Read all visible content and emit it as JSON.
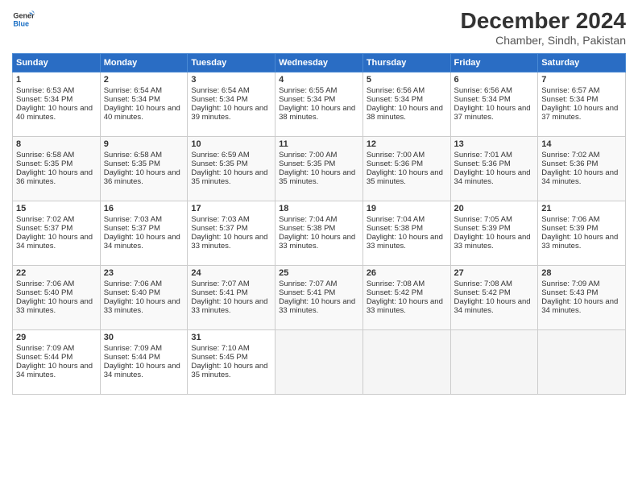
{
  "header": {
    "logo_line1": "General",
    "logo_line2": "Blue",
    "month": "December 2024",
    "location": "Chamber, Sindh, Pakistan"
  },
  "days_of_week": [
    "Sunday",
    "Monday",
    "Tuesday",
    "Wednesday",
    "Thursday",
    "Friday",
    "Saturday"
  ],
  "weeks": [
    [
      {
        "day": "1",
        "sunrise": "6:53 AM",
        "sunset": "5:34 PM",
        "daylight": "10 hours and 40 minutes."
      },
      {
        "day": "2",
        "sunrise": "6:54 AM",
        "sunset": "5:34 PM",
        "daylight": "10 hours and 40 minutes."
      },
      {
        "day": "3",
        "sunrise": "6:54 AM",
        "sunset": "5:34 PM",
        "daylight": "10 hours and 39 minutes."
      },
      {
        "day": "4",
        "sunrise": "6:55 AM",
        "sunset": "5:34 PM",
        "daylight": "10 hours and 38 minutes."
      },
      {
        "day": "5",
        "sunrise": "6:56 AM",
        "sunset": "5:34 PM",
        "daylight": "10 hours and 38 minutes."
      },
      {
        "day": "6",
        "sunrise": "6:56 AM",
        "sunset": "5:34 PM",
        "daylight": "10 hours and 37 minutes."
      },
      {
        "day": "7",
        "sunrise": "6:57 AM",
        "sunset": "5:34 PM",
        "daylight": "10 hours and 37 minutes."
      }
    ],
    [
      {
        "day": "8",
        "sunrise": "6:58 AM",
        "sunset": "5:35 PM",
        "daylight": "10 hours and 36 minutes."
      },
      {
        "day": "9",
        "sunrise": "6:58 AM",
        "sunset": "5:35 PM",
        "daylight": "10 hours and 36 minutes."
      },
      {
        "day": "10",
        "sunrise": "6:59 AM",
        "sunset": "5:35 PM",
        "daylight": "10 hours and 35 minutes."
      },
      {
        "day": "11",
        "sunrise": "7:00 AM",
        "sunset": "5:35 PM",
        "daylight": "10 hours and 35 minutes."
      },
      {
        "day": "12",
        "sunrise": "7:00 AM",
        "sunset": "5:36 PM",
        "daylight": "10 hours and 35 minutes."
      },
      {
        "day": "13",
        "sunrise": "7:01 AM",
        "sunset": "5:36 PM",
        "daylight": "10 hours and 34 minutes."
      },
      {
        "day": "14",
        "sunrise": "7:02 AM",
        "sunset": "5:36 PM",
        "daylight": "10 hours and 34 minutes."
      }
    ],
    [
      {
        "day": "15",
        "sunrise": "7:02 AM",
        "sunset": "5:37 PM",
        "daylight": "10 hours and 34 minutes."
      },
      {
        "day": "16",
        "sunrise": "7:03 AM",
        "sunset": "5:37 PM",
        "daylight": "10 hours and 34 minutes."
      },
      {
        "day": "17",
        "sunrise": "7:03 AM",
        "sunset": "5:37 PM",
        "daylight": "10 hours and 33 minutes."
      },
      {
        "day": "18",
        "sunrise": "7:04 AM",
        "sunset": "5:38 PM",
        "daylight": "10 hours and 33 minutes."
      },
      {
        "day": "19",
        "sunrise": "7:04 AM",
        "sunset": "5:38 PM",
        "daylight": "10 hours and 33 minutes."
      },
      {
        "day": "20",
        "sunrise": "7:05 AM",
        "sunset": "5:39 PM",
        "daylight": "10 hours and 33 minutes."
      },
      {
        "day": "21",
        "sunrise": "7:06 AM",
        "sunset": "5:39 PM",
        "daylight": "10 hours and 33 minutes."
      }
    ],
    [
      {
        "day": "22",
        "sunrise": "7:06 AM",
        "sunset": "5:40 PM",
        "daylight": "10 hours and 33 minutes."
      },
      {
        "day": "23",
        "sunrise": "7:06 AM",
        "sunset": "5:40 PM",
        "daylight": "10 hours and 33 minutes."
      },
      {
        "day": "24",
        "sunrise": "7:07 AM",
        "sunset": "5:41 PM",
        "daylight": "10 hours and 33 minutes."
      },
      {
        "day": "25",
        "sunrise": "7:07 AM",
        "sunset": "5:41 PM",
        "daylight": "10 hours and 33 minutes."
      },
      {
        "day": "26",
        "sunrise": "7:08 AM",
        "sunset": "5:42 PM",
        "daylight": "10 hours and 33 minutes."
      },
      {
        "day": "27",
        "sunrise": "7:08 AM",
        "sunset": "5:42 PM",
        "daylight": "10 hours and 34 minutes."
      },
      {
        "day": "28",
        "sunrise": "7:09 AM",
        "sunset": "5:43 PM",
        "daylight": "10 hours and 34 minutes."
      }
    ],
    [
      {
        "day": "29",
        "sunrise": "7:09 AM",
        "sunset": "5:44 PM",
        "daylight": "10 hours and 34 minutes."
      },
      {
        "day": "30",
        "sunrise": "7:09 AM",
        "sunset": "5:44 PM",
        "daylight": "10 hours and 34 minutes."
      },
      {
        "day": "31",
        "sunrise": "7:10 AM",
        "sunset": "5:45 PM",
        "daylight": "10 hours and 35 minutes."
      },
      null,
      null,
      null,
      null
    ]
  ]
}
